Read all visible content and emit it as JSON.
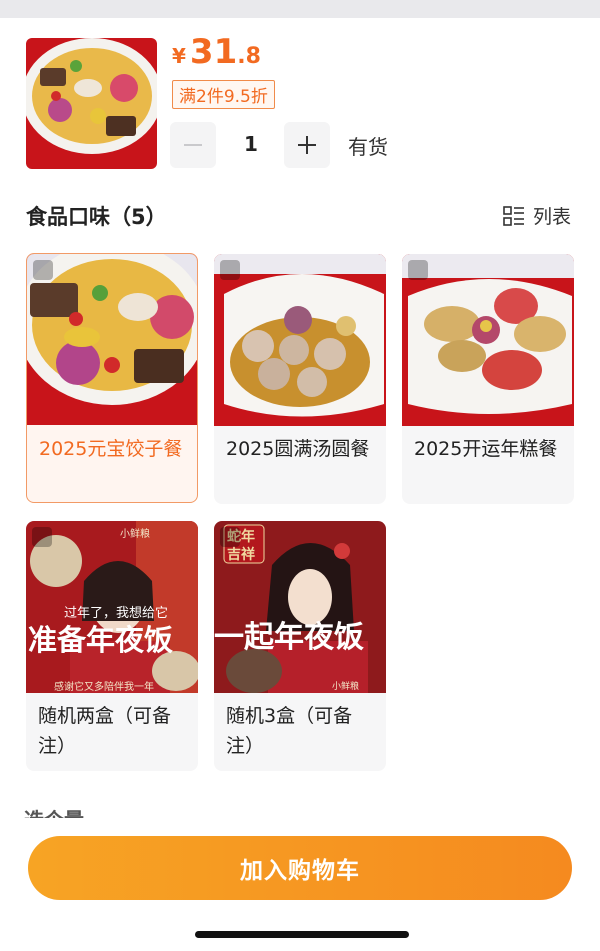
{
  "product": {
    "currency": "¥",
    "price_int": "31",
    "price_dec": ".8",
    "promo": "满2件9.5折",
    "quantity": "1",
    "stock": "有货"
  },
  "section": {
    "title": "食品口味（5）",
    "list_label": "列表"
  },
  "options": [
    {
      "label": "2025元宝饺子餐",
      "selected": true
    },
    {
      "label": "2025圆满汤圆餐",
      "selected": false
    },
    {
      "label": "2025开运年糕餐",
      "selected": false
    },
    {
      "label": "随机两盒（可备注）",
      "selected": false
    },
    {
      "label": "随机3盒（可备注）",
      "selected": false
    }
  ],
  "poster_texts": {
    "opt4_brand": "小鲜粮",
    "opt4_small": "过年了，我想给它",
    "opt4_big": "准备年夜饭",
    "opt4_bottom": "感谢它又多陪伴我一年",
    "opt5_badge1": "蛇年",
    "opt5_badge2": "吉祥",
    "opt5_big": "一起年夜饭",
    "opt5_brand": "小鲜粮"
  },
  "next_section_partial": "选个量",
  "cta": {
    "label": "加入购物车"
  },
  "colors": {
    "accent": "#f26a21",
    "cta_start": "#f7a424",
    "cta_end": "#f58a1f",
    "selected_bg": "#fff5f0"
  }
}
